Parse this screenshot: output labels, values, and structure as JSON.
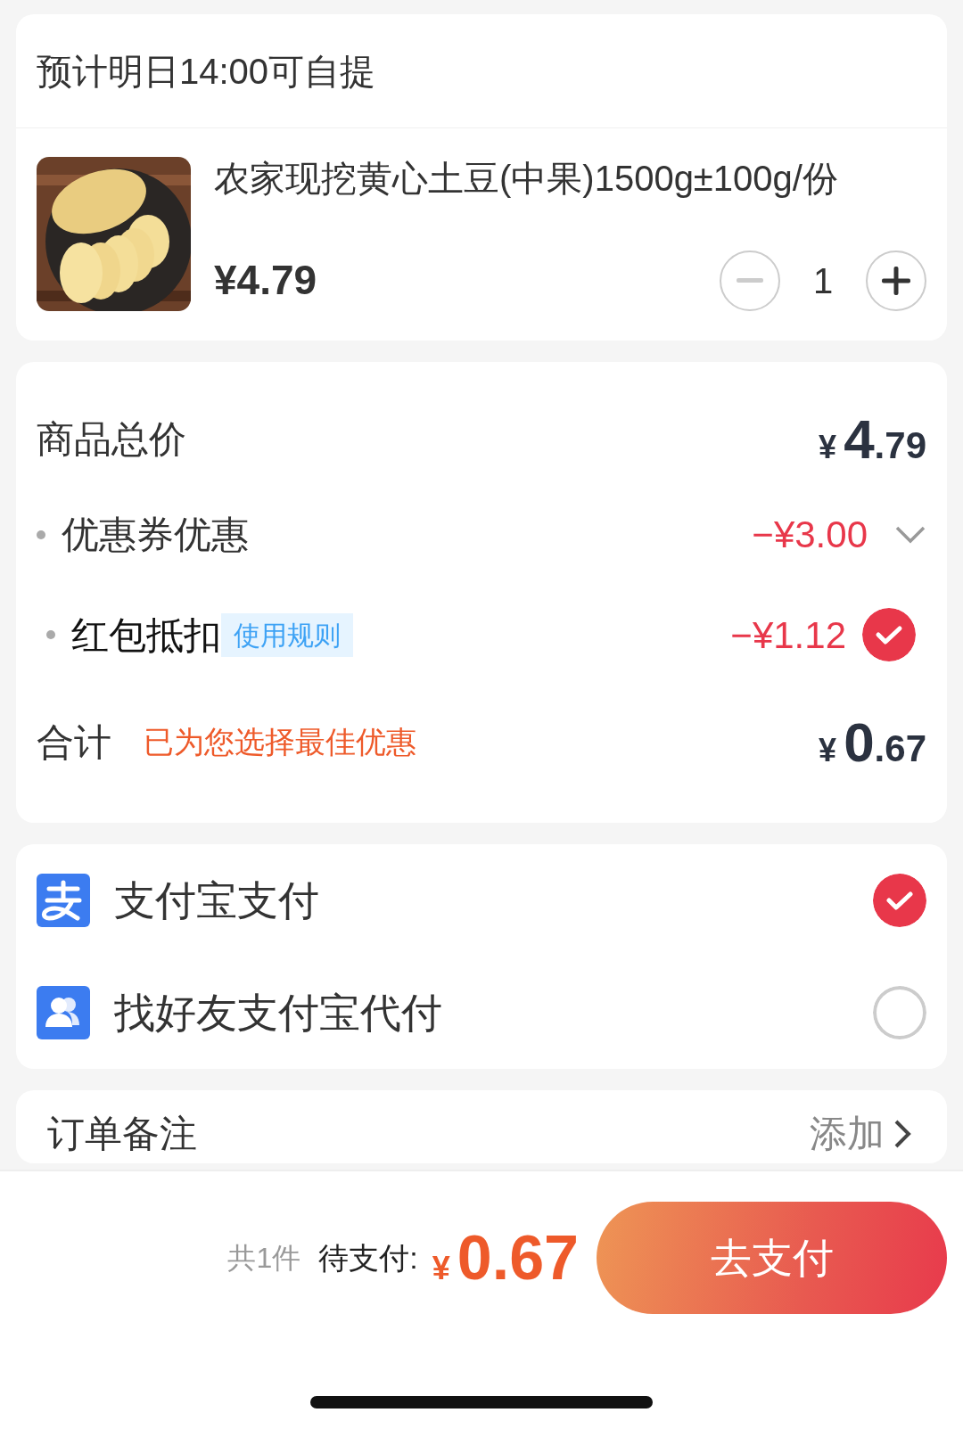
{
  "pickup": {
    "title": "预计明日14:00可自提"
  },
  "product": {
    "title": "农家现挖黄心土豆(中果)1500g±100g/份",
    "price": "¥4.79",
    "quantity": "1",
    "minus_disabled": true
  },
  "summary": {
    "rows": [
      {
        "kind": "total",
        "label": "商品总价",
        "amount": {
          "symbol": "¥",
          "integer": "4",
          "decimal": ".79"
        }
      },
      {
        "kind": "dropdown",
        "label": "优惠券优惠",
        "amount": "−¥3.00",
        "expanded": false
      },
      {
        "kind": "check",
        "label": "红包抵扣",
        "tag": "使用规则",
        "amount": "−¥1.12",
        "checked": true
      },
      {
        "kind": "sum",
        "label": "合计",
        "note": "已为您选择最佳优惠",
        "amount": {
          "symbol": "¥",
          "integer": "0",
          "decimal": ".67"
        }
      }
    ]
  },
  "payment": [
    {
      "label": "支付宝支付",
      "selected": true
    },
    {
      "label": "找好友支付宝代付",
      "selected": false
    }
  ],
  "remark": {
    "label": "订单备注",
    "action": "添加"
  },
  "footer": {
    "count": "共1件",
    "due_label": "待支付:",
    "amount": {
      "symbol": "¥",
      "integer": "0.67"
    },
    "button": "去支付"
  }
}
